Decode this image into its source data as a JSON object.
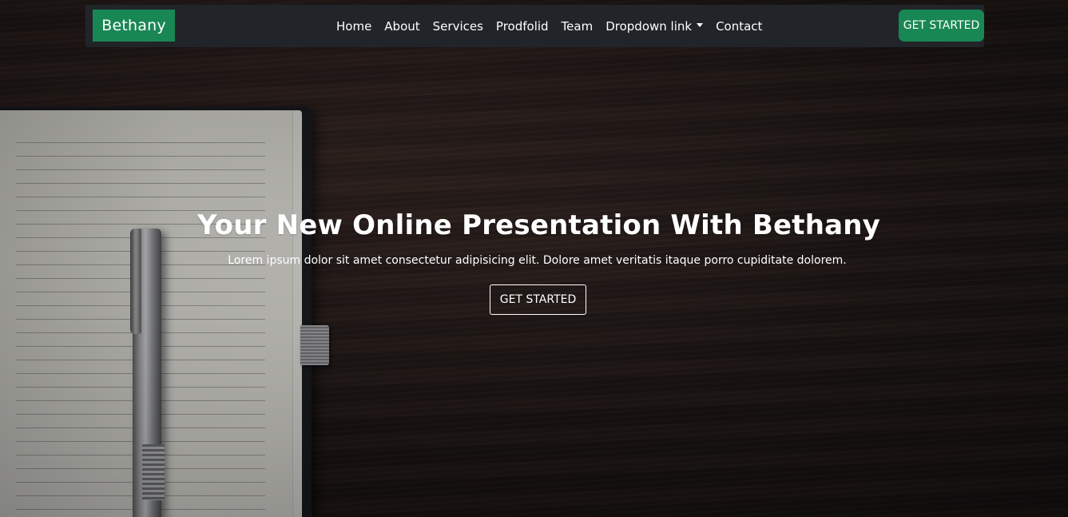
{
  "navbar": {
    "brand": "Bethany",
    "links": [
      "Home",
      "About",
      "Services",
      "Prodfolid",
      "Team",
      "Dropdown link",
      "Contact"
    ],
    "cta_label": "GET STARTED"
  },
  "hero": {
    "title": "Your New Online Presentation With Bethany",
    "subtitle": "Lorem ipsum dolor sit amet consectetur adipisicing elit. Dolore amet veritatis itaque porro cupiditate dolorem.",
    "button_label": "GET STARTED"
  },
  "colors": {
    "brand_green": "#198754",
    "navbar_bg": "#212529",
    "text": "#ffffff"
  },
  "icons": {
    "dropdown": "caret-down-icon"
  }
}
